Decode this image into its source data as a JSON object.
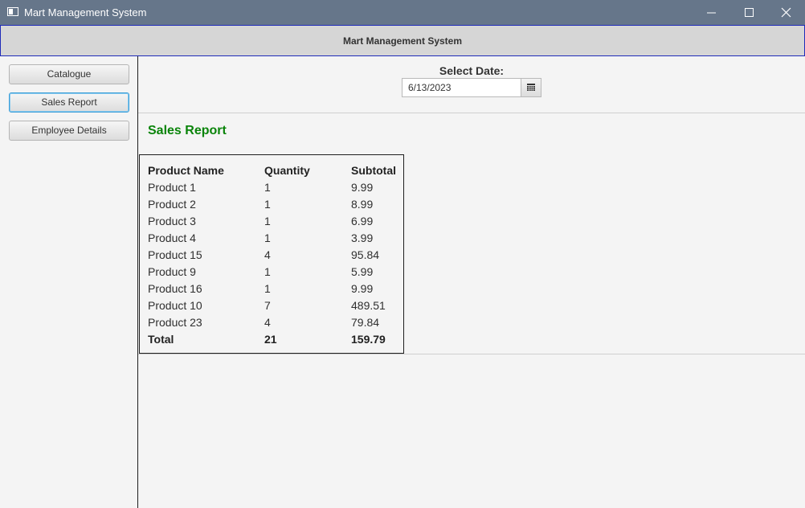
{
  "window": {
    "title": "Mart Management System",
    "icon": "app-window-icon",
    "controls": [
      "minimize-icon",
      "maximize-icon",
      "close-icon"
    ]
  },
  "header": {
    "title": "Mart Management System"
  },
  "sidebar": {
    "items": [
      {
        "label": "Catalogue"
      },
      {
        "label": "Sales Report"
      },
      {
        "label": "Employee Details"
      }
    ]
  },
  "date_picker": {
    "label": "Select Date:",
    "value": "6/13/2023",
    "icon": "calendar-icon"
  },
  "report": {
    "title": "Sales Report",
    "title_color": "#0a840a",
    "columns": [
      "Product Name",
      "Quantity",
      "Subtotal"
    ],
    "rows": [
      [
        "Product 1",
        "1",
        "9.99"
      ],
      [
        "Product 2",
        "1",
        "8.99"
      ],
      [
        "Product 3",
        "1",
        "6.99"
      ],
      [
        "Product 4",
        "1",
        "3.99"
      ],
      [
        "Product 15",
        "4",
        "95.84"
      ],
      [
        "Product 9",
        "1",
        "5.99"
      ],
      [
        "Product 16",
        "1",
        "9.99"
      ],
      [
        "Product 10",
        "7",
        "489.51"
      ],
      [
        "Product 23",
        "4",
        "79.84"
      ]
    ],
    "total": [
      "Total",
      "21",
      "159.79"
    ]
  },
  "colors": {
    "titlebar": "#66768a",
    "header_border": "#1f2bb8",
    "focus_ring": "#3f9fd7"
  }
}
